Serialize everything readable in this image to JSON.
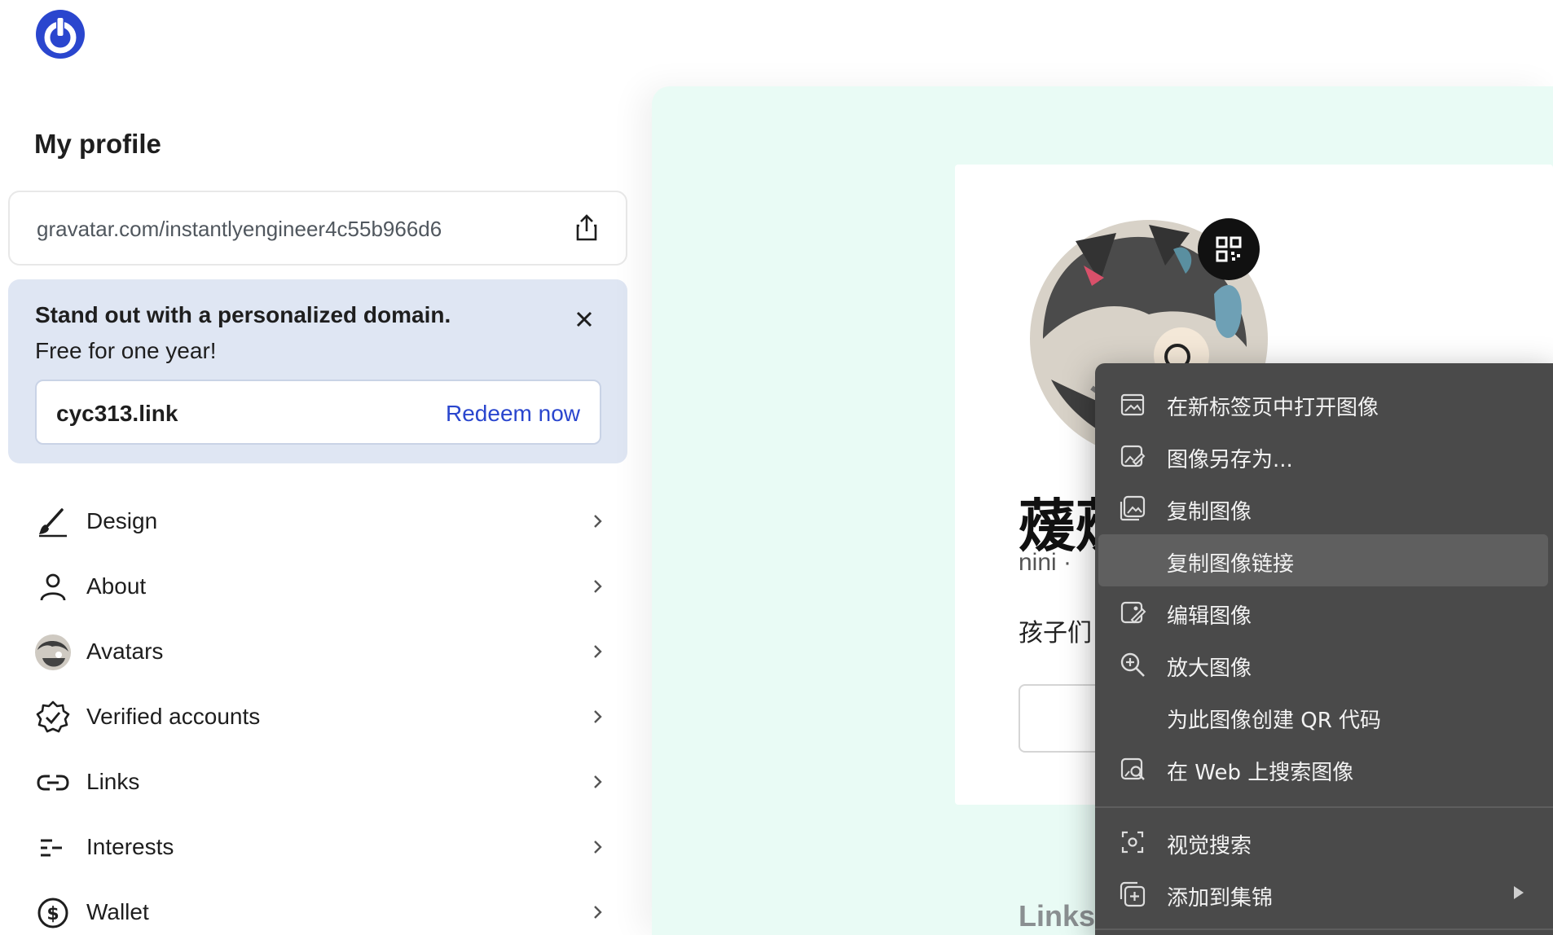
{
  "sidebar": {
    "title": "My profile",
    "profile_url": "gravatar.com/instantlyengineer4c55b966d6",
    "promo": {
      "title": "Stand out with a personalized domain.",
      "subtitle": "Free for one year!",
      "domain": "cyc313.link",
      "cta": "Redeem now"
    },
    "menu": [
      {
        "label": "Design",
        "icon": "brush-icon"
      },
      {
        "label": "About",
        "icon": "person-icon"
      },
      {
        "label": "Avatars",
        "icon": "avatar-thumbnail"
      },
      {
        "label": "Verified accounts",
        "icon": "verified-badge-icon"
      },
      {
        "label": "Links",
        "icon": "link-icon"
      },
      {
        "label": "Interests",
        "icon": "interests-icon"
      },
      {
        "label": "Wallet",
        "icon": "dollar-icon"
      }
    ]
  },
  "profile_card": {
    "display_name": "蕿蕿",
    "meta": "nini · ",
    "bio": "孩子们",
    "links_heading": "Links"
  },
  "context_menu": {
    "items": [
      {
        "label": "在新标签页中打开图像",
        "icon": "open-image-new-tab-icon"
      },
      {
        "label": "图像另存为...",
        "icon": "save-image-icon"
      },
      {
        "label": "复制图像",
        "icon": "copy-image-icon"
      },
      {
        "label": "复制图像链接",
        "icon": "",
        "highlighted": true
      },
      {
        "label": "编辑图像",
        "icon": "edit-image-icon"
      },
      {
        "label": "放大图像",
        "icon": "zoom-in-icon"
      },
      {
        "label": "为此图像创建 QR 代码",
        "icon": ""
      },
      {
        "label": "在 Web 上搜索图像",
        "icon": "search-image-web-icon"
      },
      {
        "label": "视觉搜索",
        "icon": "visual-search-icon"
      },
      {
        "label": "添加到集锦",
        "icon": "add-to-collection-icon",
        "submenu": true
      }
    ]
  },
  "colors": {
    "brand_blue": "#2a46ce",
    "promo_bg": "#dfe6f3",
    "preview_bg": "#e9fbf5",
    "context_menu_bg": "#4a4a4a"
  }
}
